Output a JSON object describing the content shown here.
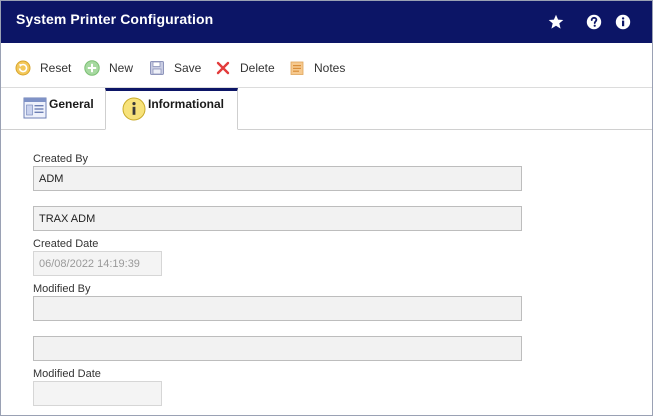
{
  "window": {
    "title": "System Printer Configuration",
    "header_icons": [
      "star-icon",
      "help-icon",
      "info-icon"
    ]
  },
  "toolbar": {
    "reset_label": "Reset",
    "new_label": "New",
    "save_label": "Save",
    "delete_label": "Delete",
    "notes_label": "Notes"
  },
  "tabs": {
    "general_label": "General",
    "informational_label": "Informational",
    "active": "Informational"
  },
  "form": {
    "created_by_label": "Created By",
    "created_by_value": "ADM",
    "created_by_name_value": "TRAX ADM",
    "created_date_label": "Created Date",
    "created_date_value": "06/08/2022 14:19:39",
    "modified_by_label": "Modified By",
    "modified_by_value": "",
    "modified_by_name_value": "",
    "modified_date_label": "Modified Date",
    "modified_date_value": ""
  },
  "colors": {
    "titlebar": "#0c1566",
    "accent_tab": "#0c1566"
  }
}
